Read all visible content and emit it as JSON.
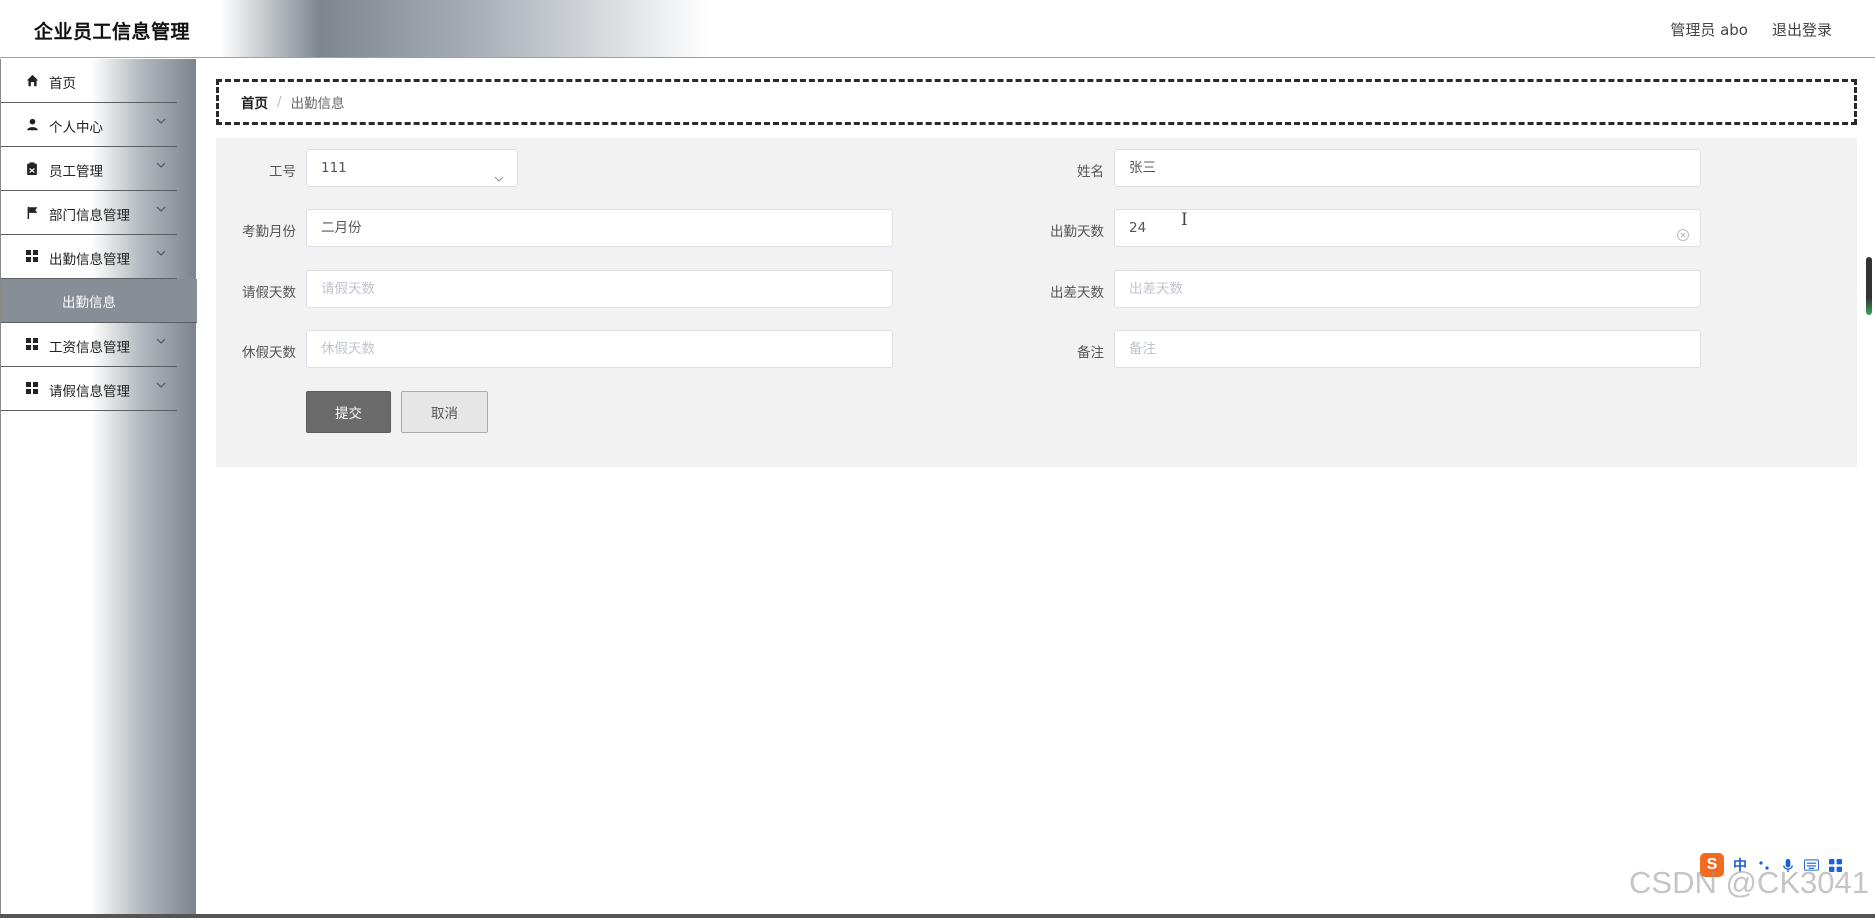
{
  "app": {
    "title": "企业员工信息管理",
    "user_label": "管理员 abo",
    "logout_label": "退出登录"
  },
  "sidebar": {
    "items": [
      {
        "label": "首页",
        "icon": "home-icon",
        "expandable": false
      },
      {
        "label": "个人中心",
        "icon": "user-icon",
        "expandable": true
      },
      {
        "label": "员工管理",
        "icon": "clipboard-icon",
        "expandable": true
      },
      {
        "label": "部门信息管理",
        "icon": "flag-icon",
        "expandable": true
      },
      {
        "label": "出勤信息管理",
        "icon": "grid-icon",
        "expandable": true,
        "expanded": true,
        "children": [
          {
            "label": "出勤信息",
            "active": true
          }
        ]
      },
      {
        "label": "工资信息管理",
        "icon": "grid-icon",
        "expandable": true
      },
      {
        "label": "请假信息管理",
        "icon": "grid-icon",
        "expandable": true
      }
    ]
  },
  "breadcrumb": {
    "home": "首页",
    "separator": "/",
    "current": "出勤信息"
  },
  "form": {
    "employee_no": {
      "label": "工号",
      "value": "111"
    },
    "name": {
      "label": "姓名",
      "value": "张三"
    },
    "month": {
      "label": "考勤月份",
      "value": "二月份"
    },
    "attendance_days": {
      "label": "出勤天数",
      "value": "24"
    },
    "leave_days": {
      "label": "请假天数",
      "placeholder": "请假天数"
    },
    "trip_days": {
      "label": "出差天数",
      "placeholder": "出差天数"
    },
    "rest_days": {
      "label": "休假天数",
      "placeholder": "休假天数"
    },
    "remark": {
      "label": "备注",
      "placeholder": "备注"
    },
    "submit_label": "提交",
    "cancel_label": "取消"
  },
  "ime": {
    "badge": "S",
    "mode": "中"
  },
  "watermark": "CSDN @CK3041",
  "colors": {
    "submit_bg": "#6b6b6b",
    "active_submenu_bg": "#878e95",
    "form_panel_bg": "#f2f2f2"
  }
}
